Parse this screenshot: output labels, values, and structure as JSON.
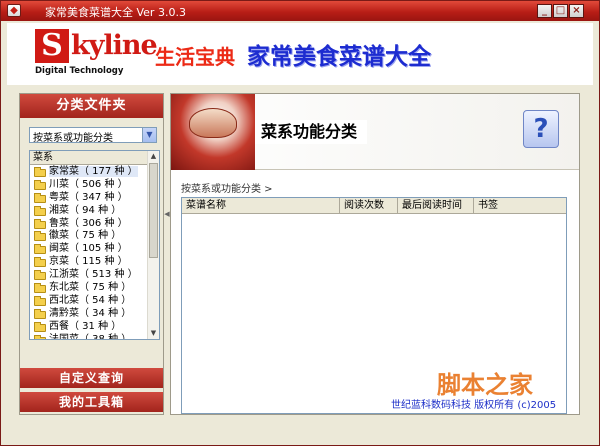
{
  "window": {
    "title": "家常美食菜谱大全 Ver 3.0.3",
    "controls": {
      "minimize": "_",
      "maximize": "□",
      "close": "×"
    }
  },
  "header": {
    "logo_letter": "S",
    "logo_word": "kyline",
    "logo_sub": "Digital Technology",
    "slogan": "生活宝典",
    "app_name": "家常美食菜谱大全"
  },
  "sidebar": {
    "title": "分类文件夹",
    "dropdown_value": "按菜系或功能分类",
    "tree_header": "菜系",
    "items": [
      {
        "label": "家常菜（ 177 种 ）"
      },
      {
        "label": "川菜（ 506 种 ）"
      },
      {
        "label": "粤菜（ 347 种 ）"
      },
      {
        "label": "湘菜（ 94 种 ）"
      },
      {
        "label": "鲁菜（ 306 种 ）"
      },
      {
        "label": "徽菜（ 75 种 ）"
      },
      {
        "label": "闽菜（ 105 种 ）"
      },
      {
        "label": "京菜（ 115 种 ）"
      },
      {
        "label": "江浙菜（ 513 种 ）"
      },
      {
        "label": "东北菜（ 75 种 ）"
      },
      {
        "label": "西北菜（ 54 种 ）"
      },
      {
        "label": "清黔菜（ 34 种 ）"
      },
      {
        "label": "西餐（ 31 种 ）"
      },
      {
        "label": "法国菜（ 38 种 ）"
      }
    ],
    "buttons": {
      "custom_query": "自定义查询",
      "my_tools": "我的工具箱"
    }
  },
  "main": {
    "banner_title": "菜系功能分类",
    "help_symbol": "?",
    "breadcrumb": "按菜系或功能分类 >",
    "columns": [
      "菜谱名称",
      "阅读次数",
      "最后阅读时间",
      "书签"
    ]
  },
  "footer": {
    "copyright": "世纪蓝科数码科技  版权所有 (c)2005",
    "watermark": "脚本之家"
  },
  "colors": {
    "titlebar_red": "#b81e16",
    "accent_blue": "#1d2cd0",
    "slogan_red": "#ec2a16"
  }
}
